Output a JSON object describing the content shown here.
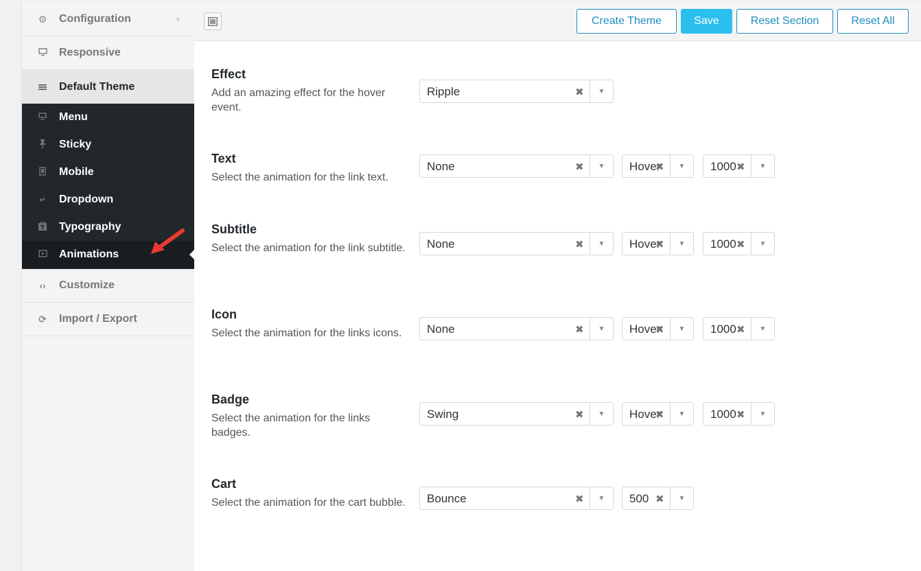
{
  "sidebar": {
    "items": [
      {
        "label": "Configuration",
        "icon": "gear-icon",
        "expander": "+"
      },
      {
        "label": "Responsive",
        "icon": "monitor-icon"
      },
      {
        "label": "Default Theme",
        "icon": "menu-lines-icon"
      }
    ],
    "submenu": [
      {
        "label": "Menu",
        "icon": "monitor-icon"
      },
      {
        "label": "Sticky",
        "icon": "pin-icon"
      },
      {
        "label": "Mobile",
        "icon": "tablet-icon"
      },
      {
        "label": "Dropdown",
        "icon": "return-arrow-icon"
      },
      {
        "label": "Typography",
        "icon": "typography-icon"
      },
      {
        "label": "Animations",
        "icon": "video-icon"
      }
    ],
    "bottom_items": [
      {
        "label": "Customize",
        "icon": "code-icon"
      },
      {
        "label": "Import / Export",
        "icon": "refresh-icon"
      }
    ],
    "accent_color": "#22272c"
  },
  "toolbar": {
    "create_theme": "Create Theme",
    "save": "Save",
    "reset_section": "Reset Section",
    "reset_all": "Reset All",
    "accent_color": "#2bbfee"
  },
  "fields": [
    {
      "title": "Effect",
      "desc": "Add an amazing effect for the hover event.",
      "select": "Ripple"
    },
    {
      "title": "Text",
      "desc": "Select the animation for the link text.",
      "select": "None",
      "trigger": "Hover",
      "duration": "1000"
    },
    {
      "title": "Subtitle",
      "desc": "Select the animation for the link subtitle.",
      "select": "None",
      "trigger": "Hover",
      "duration": "1000"
    },
    {
      "title": "Icon",
      "desc": "Select the animation for the links icons.",
      "select": "None",
      "trigger": "Hover",
      "duration": "1000"
    },
    {
      "title": "Badge",
      "desc": "Select the animation for the links badges.",
      "select": "Swing",
      "trigger": "Hover",
      "duration": "1000"
    },
    {
      "title": "Cart",
      "desc": "Select the animation for the cart bubble.",
      "select": "Bounce",
      "duration": "500"
    }
  ],
  "clear_glyph": "✖",
  "dropdown_glyph": "▼"
}
